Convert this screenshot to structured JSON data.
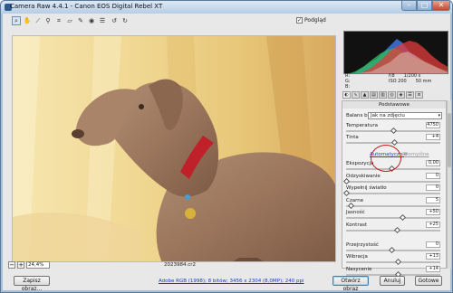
{
  "window": {
    "title": "Camera Raw 4.4.1  -  Canon EOS Digital Rebel XT"
  },
  "toolbar": {
    "tools": [
      "zoom-icon",
      "hand-icon",
      "white-balance-icon",
      "color-sampler-icon",
      "crop-icon",
      "straighten-icon",
      "retouch-icon",
      "red-eye-icon",
      "preferences-icon",
      "rotate-left-icon",
      "rotate-right-icon"
    ],
    "preview_label": "Podgląd",
    "preview_checked": true
  },
  "canvas": {
    "zoom": "24,4%",
    "filename": "2023984.cr2"
  },
  "readout": {
    "r": "R:",
    "g": "G:",
    "b": "B:",
    "aperture": "f/8",
    "shutter": "1/200 s",
    "iso": "ISO 200",
    "focal": "50 mm"
  },
  "panel": {
    "title": "Podstawowe",
    "white_balance_label": "Balans bieli:",
    "white_balance_value": "Jak na zdjęciu",
    "auto_link": "Automatycznie",
    "default_link": "Domyślne",
    "sliders": [
      {
        "label": "Temperatura",
        "value": "4750",
        "pos": 0.52
      },
      {
        "label": "Tinta",
        "value": "+4",
        "pos": 0.53
      },
      {
        "label": "Ekspozycja",
        "value": "0,00",
        "pos": 0.5
      },
      {
        "label": "Odzyskiwanie",
        "value": "0",
        "pos": 0.0
      },
      {
        "label": "Wypełnij światło",
        "value": "0",
        "pos": 0.0
      },
      {
        "label": "Czarne",
        "value": "5",
        "pos": 0.05
      },
      {
        "label": "Jasność",
        "value": "+50",
        "pos": 0.62
      },
      {
        "label": "Kontrast",
        "value": "+25",
        "pos": 0.56
      },
      {
        "label": "Przejrzystość",
        "value": "0",
        "pos": 0.5
      },
      {
        "label": "Wibracja",
        "value": "+13",
        "pos": 0.57
      },
      {
        "label": "Nasycenie",
        "value": "+14",
        "pos": 0.57
      }
    ]
  },
  "bottom": {
    "save_label": "Zapisz obraz...",
    "info_link": "Adobe RGB (1998); 8 bitów; 3456 x 2304 (8,0MP); 240 ppi",
    "open_label": "Otwórz obraz",
    "cancel_label": "Anuluj",
    "done_label": "Gotowe"
  },
  "colors": {
    "accent": "#3c7fb1",
    "link": "#1a3fbf",
    "highlight_circle": "#c21f1f"
  }
}
